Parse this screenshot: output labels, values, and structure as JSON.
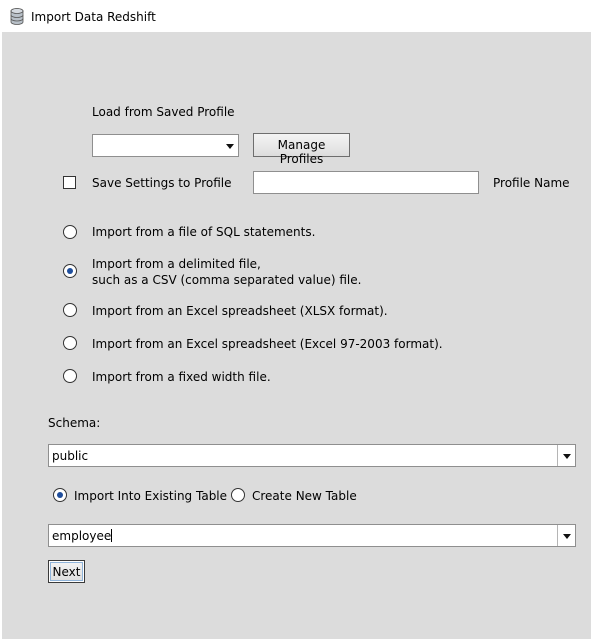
{
  "window": {
    "title": "Import Data Redshift",
    "icon": "database-icon"
  },
  "profile": {
    "load_label": "Load from Saved Profile",
    "selected_profile": "",
    "manage_button": "Manage Profiles",
    "save_checkbox_label": "Save Settings to Profile",
    "save_checked": false,
    "profile_name_value": "",
    "profile_name_label": "Profile Name"
  },
  "import_options": [
    {
      "line1": "Import from a file of SQL statements.",
      "line2": "",
      "selected": false
    },
    {
      "line1": "Import from a delimited file,",
      "line2": "such as a CSV (comma separated value) file.",
      "selected": true
    },
    {
      "line1": "Import from an Excel spreadsheet (XLSX format).",
      "line2": "",
      "selected": false
    },
    {
      "line1": "Import from an Excel spreadsheet (Excel 97-2003 format).",
      "line2": "",
      "selected": false
    },
    {
      "line1": "Import from a fixed width file.",
      "line2": "",
      "selected": false
    }
  ],
  "schema": {
    "label": "Schema:",
    "value": "public"
  },
  "table_mode": {
    "existing_label": "Import Into Existing Table",
    "existing_selected": true,
    "new_label": "Create New Table",
    "new_selected": false
  },
  "table": {
    "value": "employee"
  },
  "next_button": "Next",
  "colors": {
    "panel_bg": "#dcdcdc",
    "radio_dot": "#1f4e9c"
  }
}
